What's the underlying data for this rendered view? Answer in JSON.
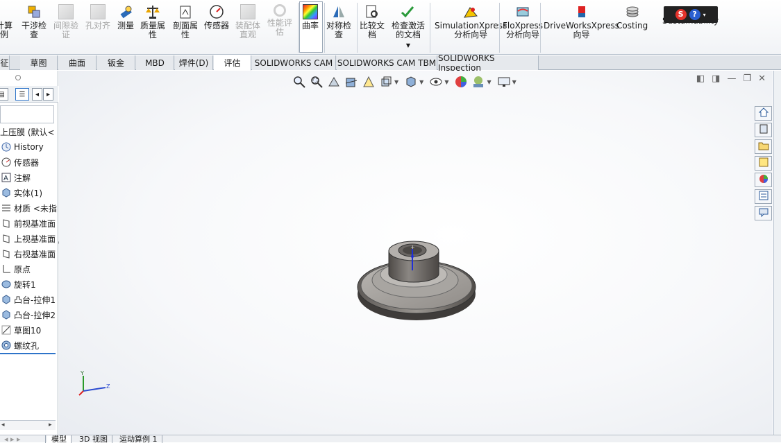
{
  "ribbon": {
    "items": [
      {
        "id": "calc",
        "label": "计算\n例",
        "disabled": false
      },
      {
        "id": "interference",
        "label": "干涉检\n查",
        "disabled": false
      },
      {
        "id": "clearance",
        "label": "间隙验\n证",
        "disabled": true
      },
      {
        "id": "hole-align",
        "label": "孔对齐",
        "disabled": true
      },
      {
        "id": "measure",
        "label": "测量",
        "disabled": false
      },
      {
        "id": "mass-props",
        "label": "质量属\n性",
        "disabled": false
      },
      {
        "id": "section-props",
        "label": "剖面属\n性",
        "disabled": false
      },
      {
        "id": "sensor",
        "label": "传感器",
        "disabled": false
      },
      {
        "id": "assembly-vis",
        "label": "装配体\n直观",
        "disabled": true
      },
      {
        "id": "perf-eval",
        "label": "性能评\n估",
        "disabled": true
      },
      {
        "id": "curvature",
        "label": "曲率",
        "disabled": false
      },
      {
        "id": "symmetry",
        "label": "对称检\n查",
        "disabled": false
      },
      {
        "id": "compare",
        "label": "比较文\n档",
        "disabled": false
      },
      {
        "id": "check-active",
        "label": "检查激活\n的文档",
        "disabled": false
      },
      {
        "id": "simxpress",
        "label": "SimulationXpress\n分析向导",
        "disabled": false
      },
      {
        "id": "floxpress",
        "label": "FloXpress\n分析向导",
        "disabled": false
      },
      {
        "id": "driveworks",
        "label": "DriveWorksXpress\n向导",
        "disabled": false
      },
      {
        "id": "costing",
        "label": "Costing",
        "disabled": false
      },
      {
        "id": "sustainability",
        "label": "Sustainability",
        "disabled": false
      }
    ]
  },
  "tabs": [
    {
      "label": "征"
    },
    {
      "label": "草图"
    },
    {
      "label": "曲面"
    },
    {
      "label": "钣金"
    },
    {
      "label": "MBD"
    },
    {
      "label": "焊件(D)"
    },
    {
      "label": "评估"
    },
    {
      "label": "SOLIDWORKS CAM"
    },
    {
      "label": "SOLIDWORKS CAM TBM"
    },
    {
      "label": "SOLIDWORKS Inspection"
    }
  ],
  "tree": {
    "root": "上压膜 (默认<",
    "items": [
      {
        "label": "History",
        "icon": "history-icon"
      },
      {
        "label": "传感器",
        "icon": "sensor-icon"
      },
      {
        "label": "注解",
        "icon": "annotation-icon"
      },
      {
        "label": "实体(1)",
        "icon": "solid-body-icon"
      },
      {
        "label": "材质 <未指",
        "icon": "material-icon"
      },
      {
        "label": "前视基准面",
        "icon": "plane-icon"
      },
      {
        "label": "上视基准面",
        "icon": "plane-icon"
      },
      {
        "label": "右视基准面",
        "icon": "plane-icon"
      },
      {
        "label": "原点",
        "icon": "origin-icon"
      },
      {
        "label": "旋转1",
        "icon": "revolve-icon"
      },
      {
        "label": "凸台-拉伸1",
        "icon": "extrude-icon"
      },
      {
        "label": "凸台-拉伸2",
        "icon": "extrude-icon"
      },
      {
        "label": "草图10",
        "icon": "sketch-icon"
      },
      {
        "label": "螺纹孔",
        "icon": "thread-hole-icon"
      }
    ]
  },
  "triad": {
    "y": "Y",
    "z": "Z"
  },
  "bottom_tabs": [
    {
      "label": "模型"
    },
    {
      "label": "3D 视图"
    },
    {
      "label": "运动算例 1"
    }
  ],
  "colors": {
    "accent": "#2e74c9",
    "part": "#8e8a86"
  }
}
